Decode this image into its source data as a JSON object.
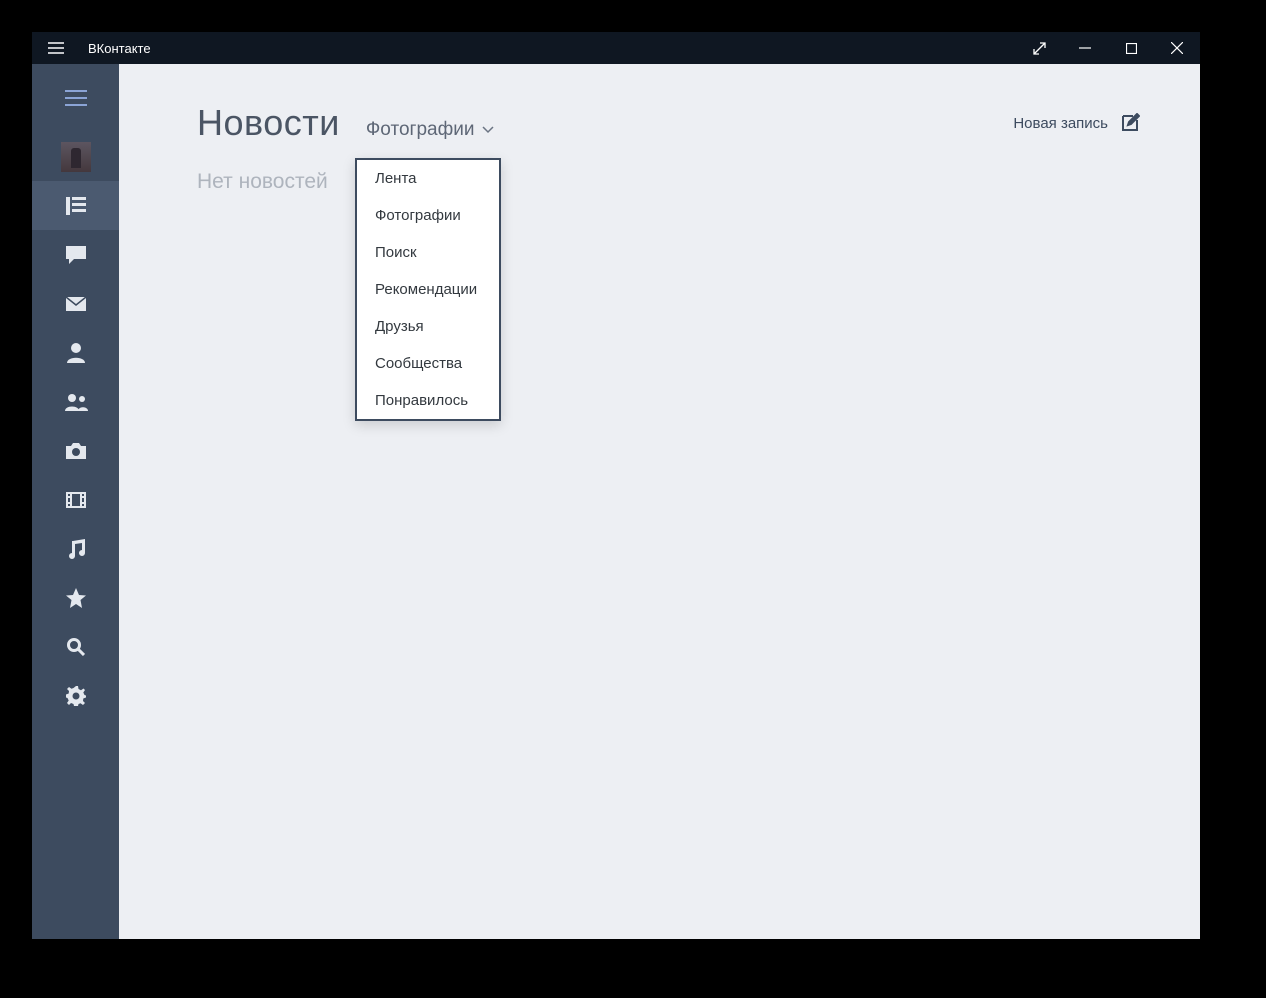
{
  "titlebar": {
    "app_name": "ВКонтакте"
  },
  "sidebar": {
    "items": [
      {
        "name": "menu"
      },
      {
        "name": "profile"
      },
      {
        "name": "news"
      },
      {
        "name": "messages"
      },
      {
        "name": "mail"
      },
      {
        "name": "user"
      },
      {
        "name": "friends"
      },
      {
        "name": "photos"
      },
      {
        "name": "videos"
      },
      {
        "name": "music"
      },
      {
        "name": "bookmarks"
      },
      {
        "name": "search"
      },
      {
        "name": "settings"
      }
    ]
  },
  "main": {
    "page_title": "Новости",
    "filter_selected": "Фотографии",
    "new_post_label": "Новая запись",
    "empty_label": "Нет новостей"
  },
  "dropdown": {
    "items": [
      "Лента",
      "Фотографии",
      "Поиск",
      "Рекомендации",
      "Друзья",
      "Сообщества",
      "Понравилось"
    ]
  }
}
